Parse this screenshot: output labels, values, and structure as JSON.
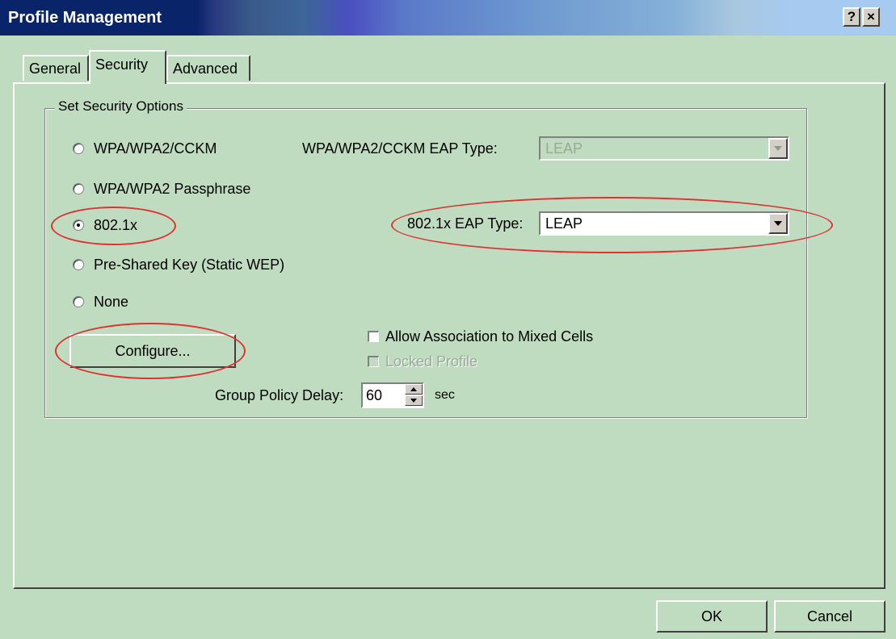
{
  "window": {
    "title": "Profile Management",
    "help_label": "?",
    "close_label": "×"
  },
  "tabs": [
    {
      "label": "General"
    },
    {
      "label": "Security",
      "active": true
    },
    {
      "label": "Advanced"
    }
  ],
  "security": {
    "group_label": "Set Security Options",
    "options": [
      {
        "label": "WPA/WPA2/CCKM",
        "selected": false
      },
      {
        "label": "WPA/WPA2 Passphrase",
        "selected": false
      },
      {
        "label": "802.1x",
        "selected": true
      },
      {
        "label": "Pre-Shared Key (Static WEP)",
        "selected": false
      },
      {
        "label": "None",
        "selected": false
      }
    ],
    "wpa_eap": {
      "label": "WPA/WPA2/CCKM EAP Type:",
      "value": "LEAP",
      "enabled": false
    },
    "dot1x_eap": {
      "label": "802.1x EAP Type:",
      "value": "LEAP",
      "enabled": true
    },
    "configure_label": "Configure...",
    "allow_mixed": {
      "label": "Allow Association to Mixed Cells",
      "checked": false
    },
    "locked_profile": {
      "label": "Locked Profile",
      "checked": false,
      "enabled": false
    },
    "group_policy": {
      "label": "Group Policy Delay:",
      "value": "60",
      "unit": "sec"
    }
  },
  "footer": {
    "ok_label": "OK",
    "cancel_label": "Cancel"
  },
  "colors": {
    "background": "#c0dcc0",
    "annotation": "#e03030",
    "title_dark": "#0a246a"
  }
}
